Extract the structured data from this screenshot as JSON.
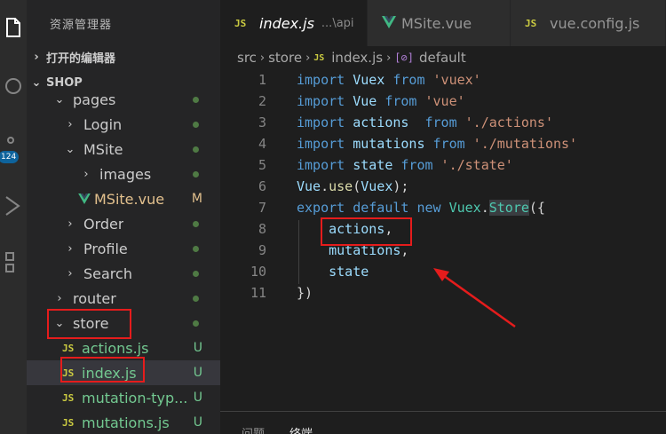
{
  "activity_bar": {
    "icons": [
      "explorer-icon",
      "search-icon",
      "source-control-icon",
      "run-debug-icon",
      "extensions-icon"
    ],
    "source_control_badge": "124"
  },
  "sidebar": {
    "title": "资源管理器",
    "open_editors_label": "打开的编辑器",
    "project_label": "SHOP",
    "tree": [
      {
        "label": "pages",
        "type": "folder",
        "expanded": true,
        "depth": 1,
        "status": "dot"
      },
      {
        "label": "Login",
        "type": "folder",
        "expanded": false,
        "depth": 2,
        "status": "dot"
      },
      {
        "label": "MSite",
        "type": "folder",
        "expanded": true,
        "depth": 2,
        "status": "dot"
      },
      {
        "label": "images",
        "type": "folder",
        "expanded": false,
        "depth": 3,
        "status": "dot"
      },
      {
        "label": "MSite.vue",
        "type": "vue",
        "depth": 3,
        "status": "M"
      },
      {
        "label": "Order",
        "type": "folder",
        "expanded": false,
        "depth": 2,
        "status": "dot"
      },
      {
        "label": "Profile",
        "type": "folder",
        "expanded": false,
        "depth": 2,
        "status": "dot"
      },
      {
        "label": "Search",
        "type": "folder",
        "expanded": false,
        "depth": 2,
        "status": "dot"
      },
      {
        "label": "router",
        "type": "folder",
        "expanded": false,
        "depth": 1,
        "status": "dot"
      },
      {
        "label": "store",
        "type": "folder",
        "expanded": true,
        "depth": 1,
        "status": "dot"
      },
      {
        "label": "actions.js",
        "type": "js",
        "depth": 2,
        "status": "U"
      },
      {
        "label": "index.js",
        "type": "js",
        "depth": 2,
        "status": "U",
        "selected": true
      },
      {
        "label": "mutation-typ...",
        "type": "js",
        "depth": 2,
        "status": "U"
      },
      {
        "label": "mutations.js",
        "type": "js",
        "depth": 2,
        "status": "U"
      }
    ]
  },
  "tabs": [
    {
      "icon": "JS",
      "label": "index.js",
      "path": "...\\api",
      "active": true
    },
    {
      "icon": "vue-icon",
      "label": "MSite.vue",
      "active": false
    },
    {
      "icon": "JS",
      "label": "vue.config.js",
      "active": false
    }
  ],
  "breadcrumb": {
    "parts": [
      "src",
      "store",
      "index.js",
      "default"
    ],
    "file_icon": "JS"
  },
  "editor": {
    "line_numbers": [
      "1",
      "2",
      "3",
      "4",
      "5",
      "6",
      "7",
      "8",
      "9",
      "10",
      "11"
    ],
    "lines": [
      [
        {
          "t": "import",
          "c": "kw"
        },
        {
          "t": " Vuex ",
          "c": "var"
        },
        {
          "t": "from",
          "c": "kw"
        },
        {
          "t": " 'vuex'",
          "c": "str"
        }
      ],
      [
        {
          "t": "import",
          "c": "kw"
        },
        {
          "t": " Vue ",
          "c": "var"
        },
        {
          "t": "from",
          "c": "kw"
        },
        {
          "t": " 'vue'",
          "c": "str"
        }
      ],
      [
        {
          "t": "import",
          "c": "kw"
        },
        {
          "t": " actions  ",
          "c": "var"
        },
        {
          "t": "from",
          "c": "kw"
        },
        {
          "t": " './actions'",
          "c": "str"
        }
      ],
      [
        {
          "t": "import",
          "c": "kw"
        },
        {
          "t": " mutations ",
          "c": "var"
        },
        {
          "t": "from",
          "c": "kw"
        },
        {
          "t": " './mutations'",
          "c": "str"
        }
      ],
      [
        {
          "t": "import",
          "c": "kw"
        },
        {
          "t": " state ",
          "c": "var"
        },
        {
          "t": "from",
          "c": "kw"
        },
        {
          "t": " './state'",
          "c": "str"
        }
      ],
      [
        {
          "t": "Vue",
          "c": "var"
        },
        {
          "t": ".",
          "c": "pn"
        },
        {
          "t": "use",
          "c": "fn"
        },
        {
          "t": "(",
          "c": "pn"
        },
        {
          "t": "Vuex",
          "c": "var"
        },
        {
          "t": ");",
          "c": "pn"
        }
      ],
      [
        {
          "t": "export default new ",
          "c": "kw"
        },
        {
          "t": "Vuex",
          "c": "cls"
        },
        {
          "t": ".",
          "c": "pn"
        },
        {
          "t": "Store",
          "c": "cls hl"
        },
        {
          "t": "({",
          "c": "pn"
        }
      ],
      [
        {
          "t": "    actions",
          "c": "var"
        },
        {
          "t": ",",
          "c": "pn"
        }
      ],
      [
        {
          "t": "    mutations",
          "c": "var"
        },
        {
          "t": ",",
          "c": "pn"
        }
      ],
      [
        {
          "t": "    state",
          "c": "var"
        }
      ],
      [
        {
          "t": "})",
          "c": "pn"
        }
      ]
    ]
  },
  "panel": {
    "tabs": [
      "问题",
      "终端"
    ]
  },
  "colors": {
    "annotation": "#e51c1c",
    "git_untracked": "#73c991",
    "git_modified": "#e2c08d",
    "js_icon": "#cbcb41",
    "vue_icon": "#41b883"
  }
}
